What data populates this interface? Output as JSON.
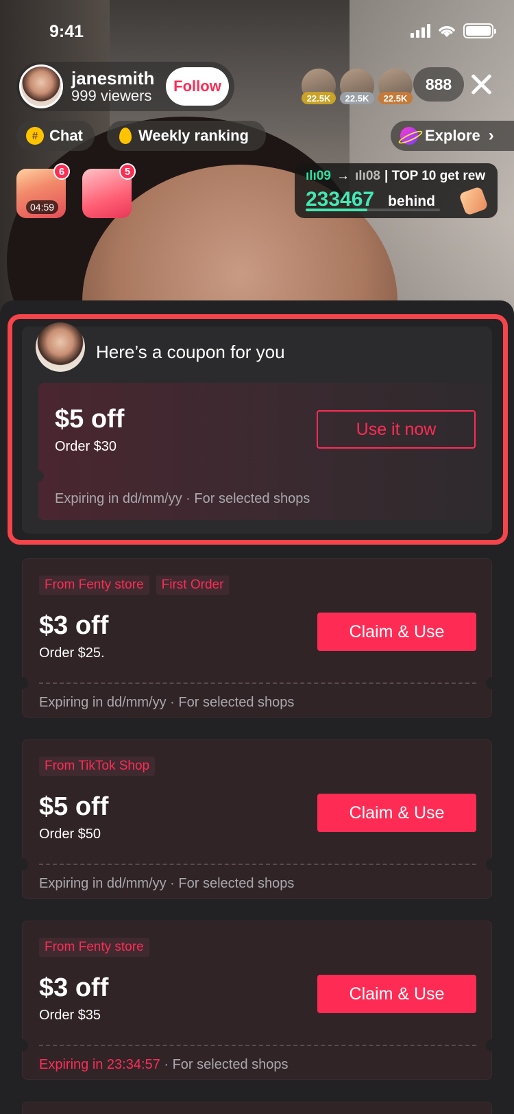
{
  "status_bar": {
    "time": "9:41"
  },
  "host": {
    "name": "janesmith",
    "viewers": "999 viewers",
    "follow_label": "Follow"
  },
  "top_viewers": [
    {
      "badge": "22.5K",
      "badge_color": "#c9a227"
    },
    {
      "badge": "22.5K",
      "badge_color": "#9aa0a6"
    },
    {
      "badge": "22.5K",
      "badge_color": "#c47a3a"
    }
  ],
  "viewer_count": "888",
  "chips": {
    "chat": "Chat",
    "weekly": "Weekly ranking",
    "explore": "Explore"
  },
  "gifts": [
    {
      "count": "6",
      "timer": "04:59"
    },
    {
      "count": "5"
    }
  ],
  "ranking": {
    "current": "09",
    "next": "08",
    "label": "| TOP 10 get rew",
    "score": "233467",
    "behind": "behind",
    "progress": 0.46
  },
  "highlight_coupon": {
    "title": "Here’s a coupon for you",
    "amount": "$5 off",
    "order": "Order $30",
    "button": "Use it now",
    "expiry": "Expiring in dd/mm/yy · For selected shops"
  },
  "coupons": [
    {
      "tags": [
        "From Fenty store",
        "First Order"
      ],
      "amount": "$3 off",
      "order": "Order $25.",
      "button": "Claim & Use",
      "expiry_red": "",
      "expiry": "Expiring in dd/mm/yy · For selected shops"
    },
    {
      "tags": [
        "From TikTok Shop"
      ],
      "amount": "$5 off",
      "order": "Order $50",
      "button": "Claim & Use",
      "expiry_red": "",
      "expiry": "Expiring in dd/mm/yy · For selected shops"
    },
    {
      "tags": [
        "From Fenty store"
      ],
      "amount": "$3 off",
      "order": "Order $35",
      "button": "Claim & Use",
      "expiry_red": "Expiring in 23:34:57",
      "expiry": " · For selected shops"
    }
  ],
  "colors": {
    "accent": "#fe2c55",
    "highlight_border": "#f5444a",
    "rank_green": "#42e8b4"
  }
}
